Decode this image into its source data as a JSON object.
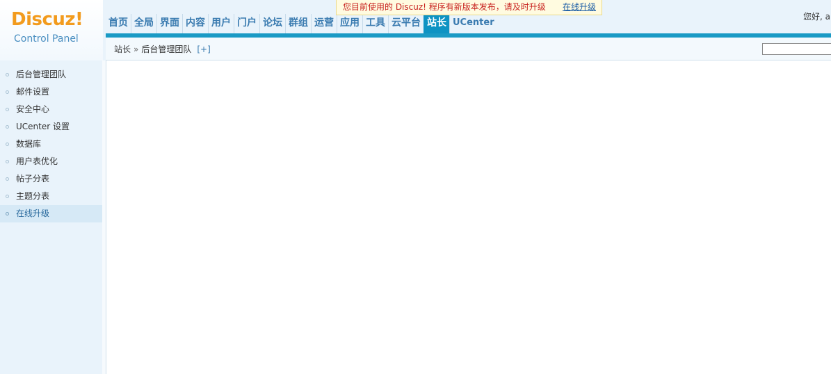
{
  "logo": {
    "brand": "Discuz!",
    "subtitle": "Control Panel"
  },
  "nav": {
    "items": [
      {
        "label": "首页"
      },
      {
        "label": "全局"
      },
      {
        "label": "界面"
      },
      {
        "label": "内容"
      },
      {
        "label": "用户"
      },
      {
        "label": "门户"
      },
      {
        "label": "论坛"
      },
      {
        "label": "群组"
      },
      {
        "label": "运营"
      },
      {
        "label": "应用"
      },
      {
        "label": "工具"
      },
      {
        "label": "云平台"
      },
      {
        "label": "站长"
      },
      {
        "label": "UCenter"
      }
    ],
    "active_index": 12
  },
  "notice": {
    "text": "您目前使用的 Discuz! 程序有新版本发布，请及时升级",
    "link": "在线升级"
  },
  "greeting": "您好, a",
  "breadcrumb": {
    "section": "站长",
    "separator": "»",
    "page": "后台管理团队",
    "add": "[+]"
  },
  "search": {
    "value": ""
  },
  "sidebar": {
    "items": [
      {
        "label": "后台管理团队"
      },
      {
        "label": "邮件设置"
      },
      {
        "label": "安全中心"
      },
      {
        "label": "UCenter 设置"
      },
      {
        "label": "数据库"
      },
      {
        "label": "用户表优化"
      },
      {
        "label": "帖子分表"
      },
      {
        "label": "主题分表"
      },
      {
        "label": "在线升级"
      }
    ],
    "active_index": 8
  },
  "colors": {
    "logo_orange": "#f29b1d",
    "nav_text": "#3a7bb0",
    "nav_active_bg": "#0e93c3",
    "notice_text": "#c8231f",
    "sidebar_bg": "#e9f3fb"
  }
}
